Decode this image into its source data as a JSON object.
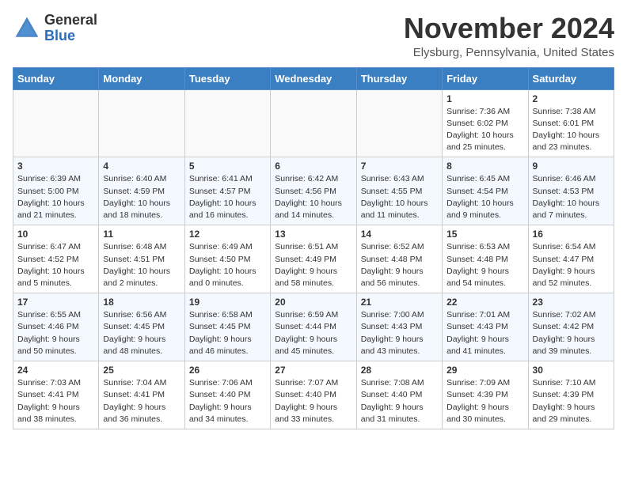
{
  "header": {
    "logo_line1": "General",
    "logo_line2": "Blue",
    "month_title": "November 2024",
    "location": "Elysburg, Pennsylvania, United States"
  },
  "weekdays": [
    "Sunday",
    "Monday",
    "Tuesday",
    "Wednesday",
    "Thursday",
    "Friday",
    "Saturday"
  ],
  "weeks": [
    [
      {
        "day": "",
        "info": ""
      },
      {
        "day": "",
        "info": ""
      },
      {
        "day": "",
        "info": ""
      },
      {
        "day": "",
        "info": ""
      },
      {
        "day": "",
        "info": ""
      },
      {
        "day": "1",
        "info": "Sunrise: 7:36 AM\nSunset: 6:02 PM\nDaylight: 10 hours and 25 minutes."
      },
      {
        "day": "2",
        "info": "Sunrise: 7:38 AM\nSunset: 6:01 PM\nDaylight: 10 hours and 23 minutes."
      }
    ],
    [
      {
        "day": "3",
        "info": "Sunrise: 6:39 AM\nSunset: 5:00 PM\nDaylight: 10 hours and 21 minutes."
      },
      {
        "day": "4",
        "info": "Sunrise: 6:40 AM\nSunset: 4:59 PM\nDaylight: 10 hours and 18 minutes."
      },
      {
        "day": "5",
        "info": "Sunrise: 6:41 AM\nSunset: 4:57 PM\nDaylight: 10 hours and 16 minutes."
      },
      {
        "day": "6",
        "info": "Sunrise: 6:42 AM\nSunset: 4:56 PM\nDaylight: 10 hours and 14 minutes."
      },
      {
        "day": "7",
        "info": "Sunrise: 6:43 AM\nSunset: 4:55 PM\nDaylight: 10 hours and 11 minutes."
      },
      {
        "day": "8",
        "info": "Sunrise: 6:45 AM\nSunset: 4:54 PM\nDaylight: 10 hours and 9 minutes."
      },
      {
        "day": "9",
        "info": "Sunrise: 6:46 AM\nSunset: 4:53 PM\nDaylight: 10 hours and 7 minutes."
      }
    ],
    [
      {
        "day": "10",
        "info": "Sunrise: 6:47 AM\nSunset: 4:52 PM\nDaylight: 10 hours and 5 minutes."
      },
      {
        "day": "11",
        "info": "Sunrise: 6:48 AM\nSunset: 4:51 PM\nDaylight: 10 hours and 2 minutes."
      },
      {
        "day": "12",
        "info": "Sunrise: 6:49 AM\nSunset: 4:50 PM\nDaylight: 10 hours and 0 minutes."
      },
      {
        "day": "13",
        "info": "Sunrise: 6:51 AM\nSunset: 4:49 PM\nDaylight: 9 hours and 58 minutes."
      },
      {
        "day": "14",
        "info": "Sunrise: 6:52 AM\nSunset: 4:48 PM\nDaylight: 9 hours and 56 minutes."
      },
      {
        "day": "15",
        "info": "Sunrise: 6:53 AM\nSunset: 4:48 PM\nDaylight: 9 hours and 54 minutes."
      },
      {
        "day": "16",
        "info": "Sunrise: 6:54 AM\nSunset: 4:47 PM\nDaylight: 9 hours and 52 minutes."
      }
    ],
    [
      {
        "day": "17",
        "info": "Sunrise: 6:55 AM\nSunset: 4:46 PM\nDaylight: 9 hours and 50 minutes."
      },
      {
        "day": "18",
        "info": "Sunrise: 6:56 AM\nSunset: 4:45 PM\nDaylight: 9 hours and 48 minutes."
      },
      {
        "day": "19",
        "info": "Sunrise: 6:58 AM\nSunset: 4:45 PM\nDaylight: 9 hours and 46 minutes."
      },
      {
        "day": "20",
        "info": "Sunrise: 6:59 AM\nSunset: 4:44 PM\nDaylight: 9 hours and 45 minutes."
      },
      {
        "day": "21",
        "info": "Sunrise: 7:00 AM\nSunset: 4:43 PM\nDaylight: 9 hours and 43 minutes."
      },
      {
        "day": "22",
        "info": "Sunrise: 7:01 AM\nSunset: 4:43 PM\nDaylight: 9 hours and 41 minutes."
      },
      {
        "day": "23",
        "info": "Sunrise: 7:02 AM\nSunset: 4:42 PM\nDaylight: 9 hours and 39 minutes."
      }
    ],
    [
      {
        "day": "24",
        "info": "Sunrise: 7:03 AM\nSunset: 4:41 PM\nDaylight: 9 hours and 38 minutes."
      },
      {
        "day": "25",
        "info": "Sunrise: 7:04 AM\nSunset: 4:41 PM\nDaylight: 9 hours and 36 minutes."
      },
      {
        "day": "26",
        "info": "Sunrise: 7:06 AM\nSunset: 4:40 PM\nDaylight: 9 hours and 34 minutes."
      },
      {
        "day": "27",
        "info": "Sunrise: 7:07 AM\nSunset: 4:40 PM\nDaylight: 9 hours and 33 minutes."
      },
      {
        "day": "28",
        "info": "Sunrise: 7:08 AM\nSunset: 4:40 PM\nDaylight: 9 hours and 31 minutes."
      },
      {
        "day": "29",
        "info": "Sunrise: 7:09 AM\nSunset: 4:39 PM\nDaylight: 9 hours and 30 minutes."
      },
      {
        "day": "30",
        "info": "Sunrise: 7:10 AM\nSunset: 4:39 PM\nDaylight: 9 hours and 29 minutes."
      }
    ]
  ]
}
